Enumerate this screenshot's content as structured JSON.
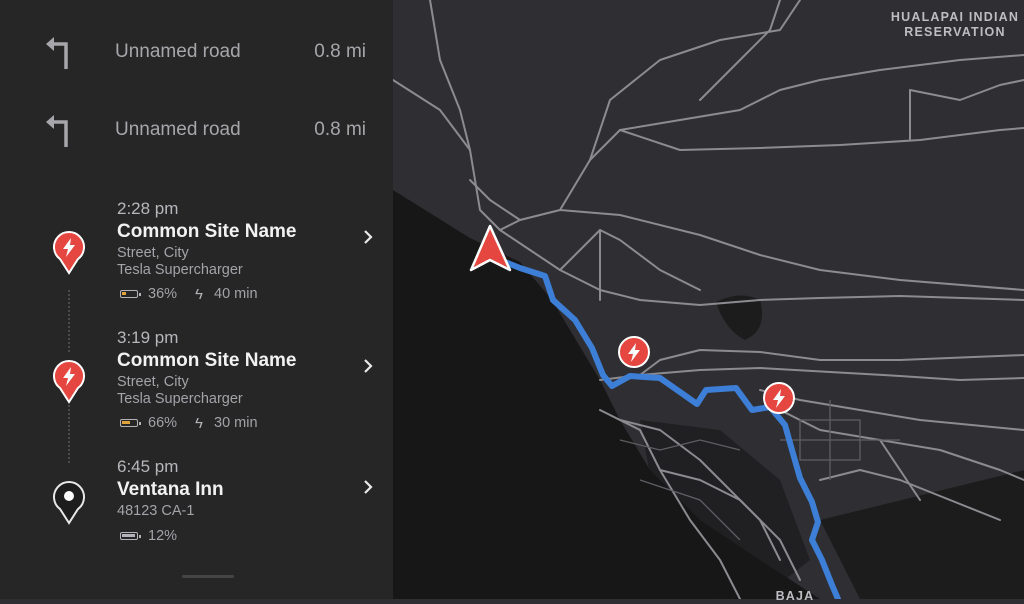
{
  "map": {
    "labels": {
      "reservation": "HUALAPAI INDIAN\nRESERVATION",
      "region": "BAJA"
    },
    "colors": {
      "route": "#3d7fd6",
      "charger_pin": "#e5463f",
      "nav_arrow": "#e5463f",
      "land": "#2f2f33",
      "water": "#161616",
      "roads": "#8d8d92"
    }
  },
  "directions": [
    {
      "road": "Unnamed road",
      "distance": "0.8 mi",
      "icon": "turn-left-icon"
    },
    {
      "road": "Unnamed road",
      "distance": "0.8 mi",
      "icon": "turn-left-icon"
    }
  ],
  "stops": [
    {
      "time": "2:28 pm",
      "name": "Common Site Name",
      "street": "Street, City",
      "type": "Tesla Supercharger",
      "battery": "36%",
      "battery_level": 0.36,
      "charge_time": "40 min",
      "icon": "supercharger-pin-icon"
    },
    {
      "time": "3:19 pm",
      "name": "Common Site Name",
      "street": "Street, City",
      "type": "Tesla Supercharger",
      "battery": "66%",
      "battery_level": 0.66,
      "charge_time": "30 min",
      "icon": "supercharger-pin-icon"
    },
    {
      "time": "6:45 pm",
      "name": "Ventana Inn",
      "street": "48123 CA-1",
      "battery": "12%",
      "battery_level": 0.12,
      "icon": "destination-pin-icon"
    }
  ]
}
